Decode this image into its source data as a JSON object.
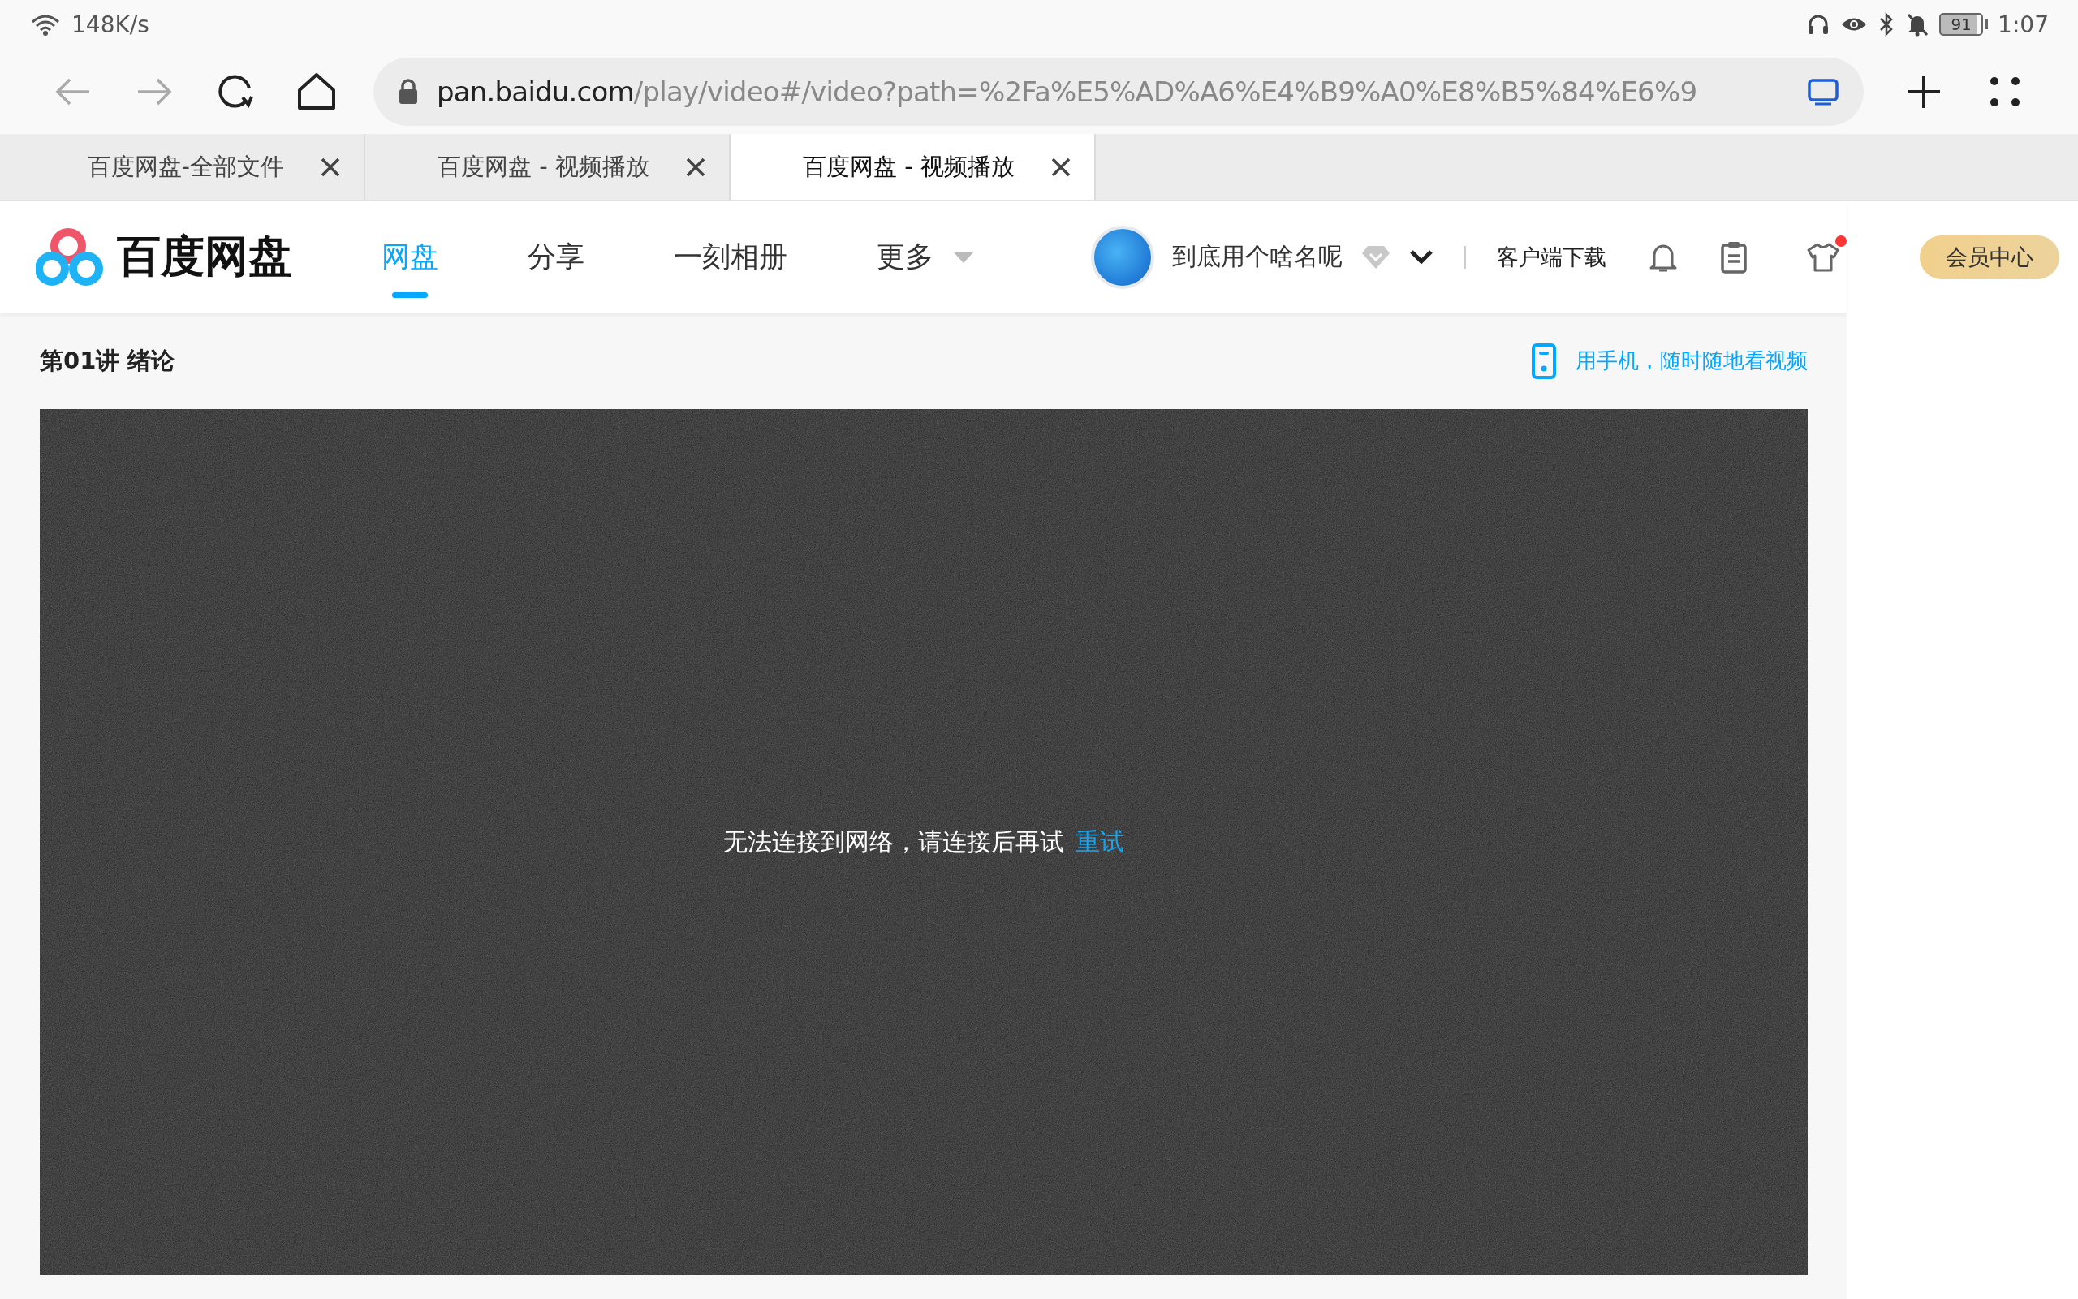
{
  "status_bar": {
    "network_speed": "148K/s",
    "battery": "91",
    "time": "1:07"
  },
  "browser": {
    "url_host": "pan.baidu.com",
    "url_path": "/play/video#/video?path=%2Fa%E5%AD%A6%E4%B9%A0%E8%B5%84%E6%9"
  },
  "tabs": [
    {
      "label": "百度网盘-全部文件",
      "selected": false
    },
    {
      "label": "百度网盘 - 视频播放",
      "selected": false
    },
    {
      "label": "百度网盘 - 视频播放",
      "selected": true
    }
  ],
  "header": {
    "logo_text": "百度网盘",
    "nav": [
      {
        "label": "网盘",
        "selected": true,
        "kind": "link"
      },
      {
        "label": "分享",
        "selected": false,
        "kind": "link"
      },
      {
        "label": "一刻相册",
        "selected": false,
        "kind": "link"
      },
      {
        "label": "更多",
        "selected": false,
        "kind": "menu"
      }
    ],
    "user_name": "到底用个啥名呢",
    "download": "客户端下载",
    "notification_dot": true,
    "vip_button": "会员中心"
  },
  "page": {
    "title": "第01讲 绪论",
    "mobile_link": "用手机，随时随地看视频",
    "error_message": "无法连接到网络，请连接后再试",
    "retry": "重试"
  }
}
